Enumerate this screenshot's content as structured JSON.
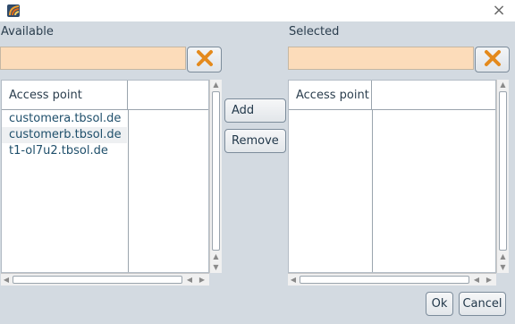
{
  "window": {
    "app_icon": "app-logo-icon",
    "close_glyph": "×",
    "close_icon": "close-icon"
  },
  "available": {
    "label": "Available",
    "filter_value": "",
    "clear_icon": "clear-x-icon",
    "columns": [
      "Access point",
      ""
    ],
    "rows": [
      "customera.tbsol.de",
      "customerb.tbsol.de",
      "t1-ol7u2.tbsol.de"
    ]
  },
  "selected": {
    "label": "Selected",
    "filter_value": "",
    "clear_icon": "clear-x-icon",
    "columns": [
      "Access point",
      ""
    ],
    "rows": []
  },
  "actions": {
    "add_label": "Add",
    "remove_label": "Remove"
  },
  "footer": {
    "ok_label": "Ok",
    "cancel_label": "Cancel"
  },
  "colors": {
    "dialog_bg": "#d3dae1",
    "filter_bg": "#fcdcba",
    "clear_icon": "#e48a1c"
  }
}
